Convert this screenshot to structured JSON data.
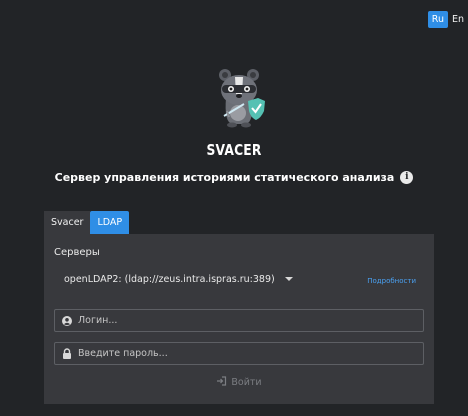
{
  "language_switch": {
    "ru_label": "Ru",
    "en_label": "En",
    "active": "Ru"
  },
  "logo": {
    "icon": "badger-mascot-icon"
  },
  "app": {
    "name": "SVACER",
    "subtitle": "Сервер управления историями статического анализа"
  },
  "tabs": [
    {
      "label": "Svacer",
      "active": false
    },
    {
      "label": "LDAP",
      "active": true
    }
  ],
  "form": {
    "servers_label": "Серверы",
    "server_selected": "openLDAP2: (ldap://zeus.intra.ispras.ru:389)",
    "details_link": "Подробности",
    "login_placeholder": "Логин...",
    "password_placeholder": "Введите пароль...",
    "login_button": "Войти"
  },
  "colors": {
    "background": "#222427",
    "panel": "#38393d",
    "accent": "#2f8ee6",
    "link": "#4aa0f0",
    "disabled_text": "#7c7e83"
  }
}
